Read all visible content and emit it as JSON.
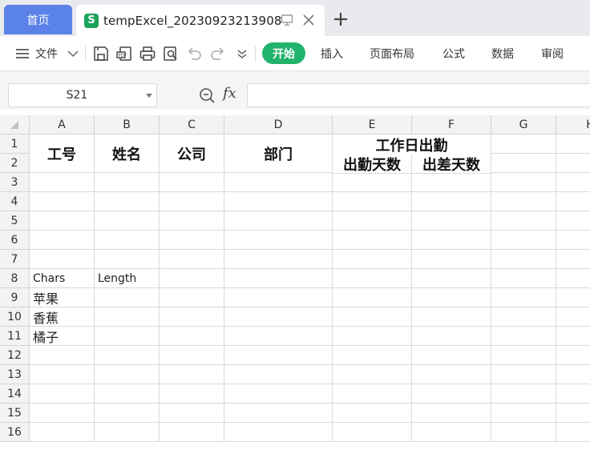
{
  "tabs": {
    "home_label": "首页",
    "file_logo": "S",
    "file_title": "tempExcel_20230923213908"
  },
  "ribbon": {
    "file_menu": "文件",
    "start": "开始",
    "insert": "插入",
    "page_layout": "页面布局",
    "formula": "公式",
    "data": "数据",
    "review": "审阅"
  },
  "formula_bar": {
    "name_box": "S21",
    "fx_label": "fx",
    "formula_value": ""
  },
  "sheet": {
    "columns": [
      "A",
      "B",
      "C",
      "D",
      "E",
      "F",
      "G",
      "H"
    ],
    "rows": [
      "1",
      "2",
      "3",
      "4",
      "5",
      "6",
      "7",
      "8",
      "9",
      "10",
      "11",
      "12",
      "13",
      "14",
      "15",
      "16"
    ],
    "header": {
      "a": "工号",
      "b": "姓名",
      "c": "公司",
      "d": "部门",
      "ef": "工作日出勤",
      "e2": "出勤天数",
      "f2": "出差天数"
    },
    "cells": {
      "a8": "Chars",
      "b8": "Length",
      "a9": "苹果",
      "a10": "香蕉",
      "a11": "橘子"
    }
  },
  "colors": {
    "home_tab": "#5b82e8",
    "start_button": "#21b36b",
    "app_logo": "#1aa35a"
  }
}
